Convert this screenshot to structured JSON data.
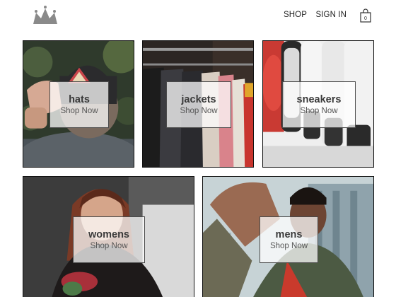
{
  "header": {
    "logo_icon": "crown-icon",
    "nav": {
      "shop_label": "SHOP",
      "signin_label": "SIGN IN"
    },
    "cart": {
      "icon": "shopping-bag-icon",
      "count": "0"
    }
  },
  "categories": [
    {
      "title": "hats",
      "cta": "Shop Now",
      "image": "man-wearing-cap-photo"
    },
    {
      "title": "jackets",
      "cta": "Shop Now",
      "image": "jackets-on-rack-photo"
    },
    {
      "title": "sneakers",
      "cta": "Shop Now",
      "image": "sneakers-row-photo"
    },
    {
      "title": "womens",
      "cta": "Shop Now",
      "image": "woman-portrait-photo"
    },
    {
      "title": "mens",
      "cta": "Shop Now",
      "image": "man-reaching-photo"
    }
  ],
  "colors": {
    "text": "#222222",
    "overlay": "#ffffff",
    "border": "#111111"
  }
}
